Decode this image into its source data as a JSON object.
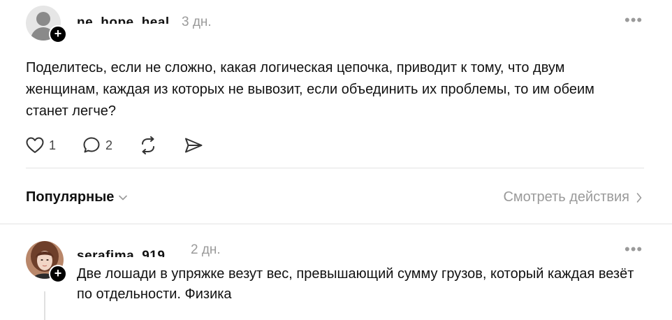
{
  "post": {
    "username": "ne_hope_heal",
    "time": "3 дн.",
    "more_label": "•••",
    "text": "Поделитесь, если не сложно, какая логическая цепочка, приводит к тому, что двум женщинам, каждая из которых не вывозит, если объединить их проблемы, то им обеим станет легче?",
    "likes": "1",
    "comments": "2",
    "follow_badge": "+"
  },
  "comments_bar": {
    "sort_label": "Популярные",
    "view_activity_label": "Смотреть действия"
  },
  "reply": {
    "username": "serafima_919",
    "time": "2 дн.",
    "more_label": "•••",
    "follow_badge": "+",
    "text": "Две лошади в упряжке везут вес, превышающий сумму грузов, который каждая везёт по отдельности. Физика"
  },
  "colors": {
    "text": "#111111",
    "muted": "#9a9a9a",
    "divider": "#e2e2e2",
    "badge": "#000000"
  }
}
